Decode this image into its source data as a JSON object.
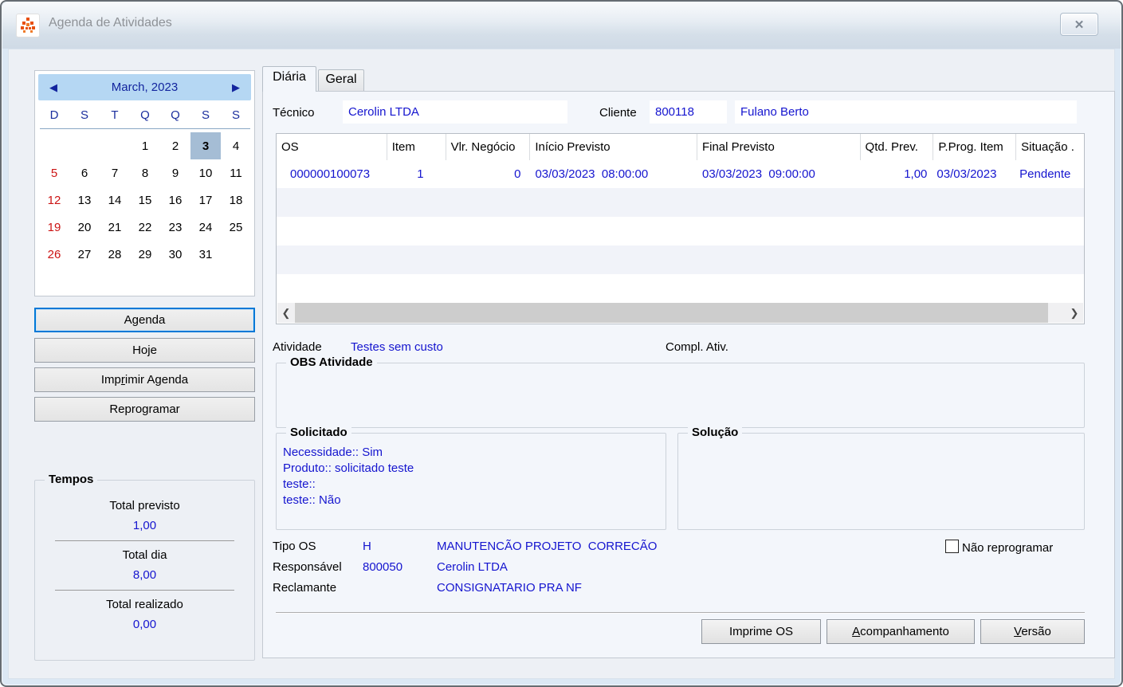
{
  "window": {
    "title": "Agenda de Atividades",
    "close_glyph": "✕"
  },
  "calendar": {
    "month_title": "March, 2023",
    "prev_glyph": "◀",
    "next_glyph": "▶",
    "weekdays": [
      "D",
      "S",
      "T",
      "Q",
      "Q",
      "S",
      "S"
    ],
    "weeks": [
      [
        "",
        "",
        "",
        "1",
        "2",
        "3",
        "4"
      ],
      [
        "5",
        "6",
        "7",
        "8",
        "9",
        "10",
        "11"
      ],
      [
        "12",
        "13",
        "14",
        "15",
        "16",
        "17",
        "18"
      ],
      [
        "19",
        "20",
        "21",
        "22",
        "23",
        "24",
        "25"
      ],
      [
        "26",
        "27",
        "28",
        "29",
        "30",
        "31",
        ""
      ]
    ],
    "selected_day": "3"
  },
  "left_buttons": {
    "agenda": "Agenda",
    "hoje": "Hoje",
    "imprimir_agenda": {
      "pre": "Imp",
      "accel": "r",
      "post": "imir Agenda"
    },
    "reprogramar": "Reprogramar"
  },
  "tempos": {
    "title": "Tempos",
    "items": [
      {
        "label": "Total previsto",
        "value": "1,00"
      },
      {
        "label": "Total dia",
        "value": "8,00"
      },
      {
        "label": "Total realizado",
        "value": "0,00"
      }
    ]
  },
  "tabs": {
    "active": "Diária",
    "inactive": "Geral"
  },
  "fields": {
    "tecnico_label": "Técnico",
    "tecnico_value": "Cerolin LTDA",
    "cliente_label": "Cliente",
    "cliente_code": "800118",
    "cliente_name": "Fulano Berto"
  },
  "grid": {
    "columns": [
      "OS",
      "Item",
      "Vlr. Negócio",
      "Início Previsto",
      "Final Previsto",
      "Qtd. Prev.",
      "P.Prog. Item",
      "Situação ."
    ],
    "rows": [
      [
        "000000100073",
        "1",
        "0",
        "03/03/2023  08:00:00",
        "03/03/2023  09:00:00",
        "1,00",
        "03/03/2023",
        "Pendente"
      ]
    ],
    "scroll_left_glyph": "❮",
    "scroll_right_glyph": "❯"
  },
  "activity": {
    "atividade_label": "Atividade",
    "atividade_value": "Testes sem custo",
    "compl_label": "Compl. Ativ.",
    "obs_title": "OBS Atividade"
  },
  "solicitado": {
    "title": "Solicitado",
    "lines": [
      "Necessidade:: Sim",
      "Produto:: solicitado teste",
      "teste::",
      "teste:: Não"
    ]
  },
  "solucao": {
    "title": "Solução"
  },
  "details": {
    "tipo_os_label": "Tipo OS",
    "tipo_os_code": "H",
    "tipo_os_desc": "MANUTENCÃO PROJETO  CORRECÃO",
    "responsavel_label": "Responsável",
    "responsavel_code": "800050",
    "responsavel_name": "Cerolin LTDA",
    "reclamante_label": "Reclamante",
    "reclamante_name": "CONSIGNATARIO PRA NF",
    "nao_reprogramar_label": "Não reprogramar",
    "nao_reprogramar_checked": false
  },
  "bottom_buttons": {
    "imprime_os": "Imprime OS",
    "acompanhamento": {
      "accel": "A",
      "rest": "companhamento"
    },
    "versao": {
      "accel": "V",
      "rest": "ersão"
    }
  },
  "colors": {
    "accent": "#0078d7",
    "value_blue": "#1515cf",
    "navy": "#13259e",
    "sunday_red": "#cc1414",
    "selected_day_bg": "#a5bdd5"
  }
}
